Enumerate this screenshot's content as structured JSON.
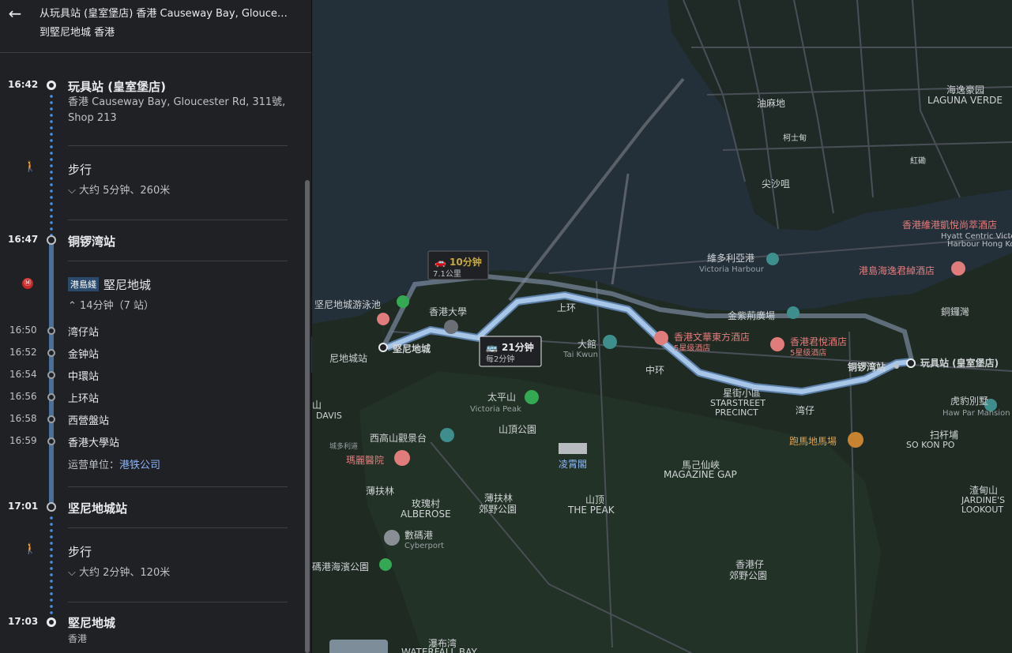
{
  "header": {
    "from": "从玩具站 (皇室堡店) 香港 Causeway Bay, Glouces…",
    "to": "到堅尼地城 香港"
  },
  "steps": {
    "start_time": "16:42",
    "start_name": "玩具站 (皇室堡店)",
    "start_addr1": "香港 Causeway Bay, Gloucester Rd, 311號,",
    "start_addr2": "Shop 213",
    "walk1_title": "步行",
    "walk1_detail": "大约 5分钟、260米",
    "station1_time": "16:47",
    "station1_name": "铜锣湾站",
    "line_badge": "港島綫",
    "line_dest": "堅尼地城",
    "ride_detail": "14分钟（7 站）",
    "stops": [
      {
        "time": "16:50",
        "name": "湾仔站"
      },
      {
        "time": "16:52",
        "name": "金钟站"
      },
      {
        "time": "16:54",
        "name": "中環站"
      },
      {
        "time": "16:56",
        "name": "上环站"
      },
      {
        "time": "16:58",
        "name": "西營盤站"
      },
      {
        "time": "16:59",
        "name": "香港大學站"
      }
    ],
    "operator_label": "运营单位：",
    "operator": "港铁公司",
    "station2_time": "17:01",
    "station2_name": "坚尼地城站",
    "walk2_title": "步行",
    "walk2_detail": "大约 2分钟、120米",
    "end_time": "17:03",
    "end_name": "堅尼地城",
    "end_sub": "香港"
  },
  "map": {
    "car_time": "10分钟",
    "car_dist": "7.1公里",
    "transit_time": "21分钟",
    "transit_freq": "每2分钟",
    "labels": [
      "香港維港凱悅尚萃酒店",
      "Hyatt Centric Victoria",
      "Harbour Hong Kong",
      "港島海逸君綽酒店",
      "銅鑼灣",
      "維多利亞港",
      "Victoria Harbour",
      "金紫荊廣場",
      "香港文華東方酒店",
      "5星级酒店",
      "香港君悅酒店",
      "5星级酒店",
      "铜锣湾站",
      "玩具站 (皇室堡店)",
      "虎豹別墅",
      "Haw Par Mansion",
      "扫杆埔",
      "SO KON PO",
      "跑馬地馬場",
      "湾仔",
      "星街小區",
      "STARSTREET",
      "PRECINCT",
      "中环",
      "大館",
      "Tai Kwun",
      "上环",
      "香港大學",
      "坚尼地城游泳池",
      "堅尼地城",
      "尼地城站",
      "太平山",
      "Victoria Peak",
      "山頂公園",
      "凌霄閣",
      "西高山觀景台",
      "瑪麗醫院",
      "薄扶林",
      "玫瑰村",
      "ALBEROSE",
      "薄扶林",
      "郊野公園",
      "山顶",
      "THE PEAK",
      "馬己仙峽",
      "MAGAZINE GAP",
      "香港仔",
      "郊野公園",
      "數碼港",
      "Cyberport",
      "瀑布湾",
      "WATERFALL BAY",
      "尖沙咀",
      "油麻地",
      "海逸豪园",
      "LAGUNA VERDE",
      "紅磡",
      "渣甸山",
      "JARDINE'S",
      "LOOKOUT",
      "DAVIS",
      "碼港海濱公園",
      "城多利道",
      "山",
      "柯士甸"
    ]
  },
  "colors": {
    "route": "#a8c7e8",
    "route_casing": "#5c7fa8",
    "car": "#7a8aa0",
    "transit": "#4b6f96",
    "walk": "#4a8df0"
  }
}
